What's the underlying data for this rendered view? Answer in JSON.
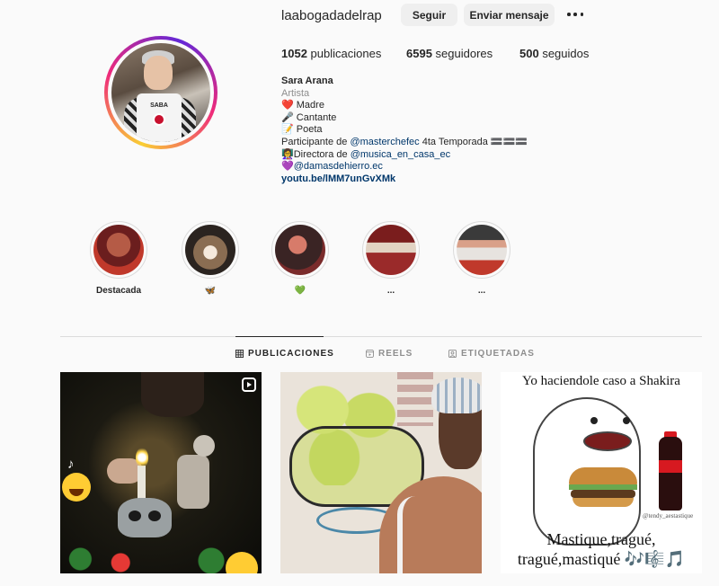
{
  "profile": {
    "username": "laabogadadelrap",
    "follow_label": "Seguir",
    "message_label": "Enviar mensaje",
    "stats": {
      "posts_count": "1052",
      "posts_label": "publicaciones",
      "followers_count": "6595",
      "followers_label": "seguidores",
      "following_count": "500",
      "following_label": "seguidos"
    },
    "avatar_apron_text": "SABA"
  },
  "bio": {
    "name": "Sara Arana",
    "category": "Artista",
    "line1_emoji": "❤️",
    "line1_text": "Madre",
    "line2_emoji": "🎤",
    "line2_text": "Cantante",
    "line3_emoji": "📝",
    "line3_text": "Poeta",
    "line4_prefix": "Participante de ",
    "line4_mention": "@masterchefec",
    "line4_suffix": " 4ta Temporada 🟰🟰🟰",
    "line5_emoji": "👩‍🏫",
    "line5_prefix": "Directora de ",
    "line5_mention": "@musica_en_casa_ec",
    "line6_emoji": "💜",
    "line6_mention": "@damasdehierro.ec",
    "link": "youtu.be/lMM7unGvXMk"
  },
  "highlights": [
    {
      "label": "Destacada"
    },
    {
      "label": "🦋"
    },
    {
      "label": "💚"
    },
    {
      "label": "..."
    },
    {
      "label": "..."
    }
  ],
  "tabs": {
    "posts": "PUBLICACIONES",
    "reels": "REELS",
    "tagged": "ETIQUETADAS"
  },
  "posts": {
    "p1_tiktok": "♪",
    "p3_caption": "Yo haciendole caso a Shakira",
    "p3_credit": "@tendy_aestastique",
    "p3_line1": "Mastique,tragué,",
    "p3_line2": "tragué,mastiqué 🎶🎼🎵"
  },
  "colors": {
    "background": "#fafafa",
    "text": "#262626",
    "muted": "#8e8e8e",
    "link": "#00376b",
    "button_bg": "#efefef"
  }
}
